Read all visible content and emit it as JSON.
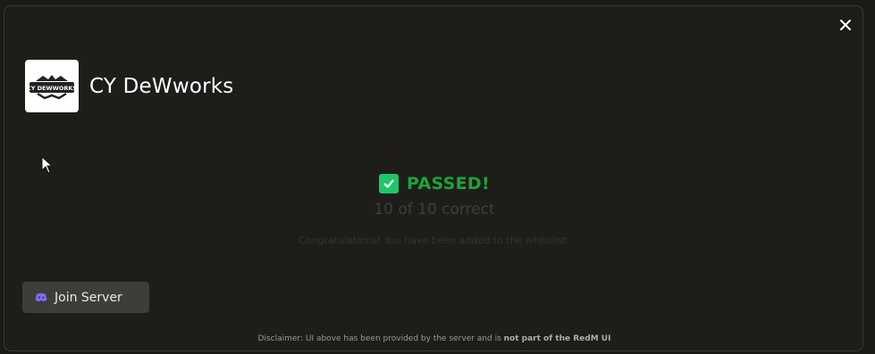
{
  "server": {
    "name": "CY DeWworks",
    "logo_text": "CY DEWWORKS"
  },
  "result": {
    "title": "PASSED!",
    "score": "10 of 10 correct",
    "message": "Congratulations! You have been added to the whitelist."
  },
  "join_button": {
    "label": "Join Server"
  },
  "disclaimer": {
    "text": "Disclaimer: UI above has been provided by the server and is ",
    "emphasis": "not part of the RedM UI"
  },
  "colors": {
    "success": "#1fa33a",
    "check_bg": "#1ec66b",
    "modal_bg": "#1e1d1a",
    "button_bg": "#3e3d39",
    "discord_purple": "#7c6cff"
  },
  "icons": {
    "close": "close-icon",
    "check": "checkmark-icon",
    "join": "discord-icon",
    "pointer": "mouse-cursor"
  }
}
